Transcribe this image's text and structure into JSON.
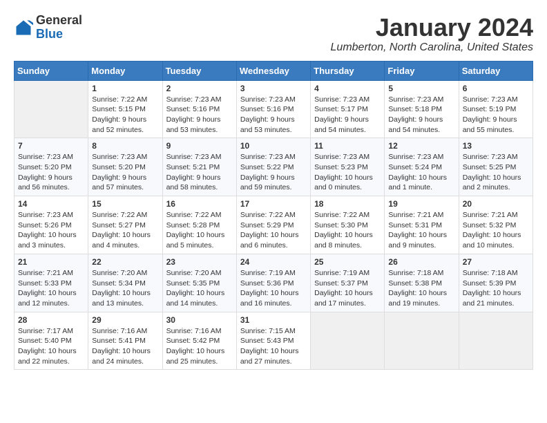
{
  "header": {
    "logo": {
      "general": "General",
      "blue": "Blue"
    },
    "title": "January 2024",
    "subtitle": "Lumberton, North Carolina, United States"
  },
  "calendar": {
    "days_of_week": [
      "Sunday",
      "Monday",
      "Tuesday",
      "Wednesday",
      "Thursday",
      "Friday",
      "Saturday"
    ],
    "weeks": [
      [
        {
          "day": "",
          "sunrise": "",
          "sunset": "",
          "daylight": ""
        },
        {
          "day": "1",
          "sunrise": "Sunrise: 7:22 AM",
          "sunset": "Sunset: 5:15 PM",
          "daylight": "Daylight: 9 hours and 52 minutes."
        },
        {
          "day": "2",
          "sunrise": "Sunrise: 7:23 AM",
          "sunset": "Sunset: 5:16 PM",
          "daylight": "Daylight: 9 hours and 53 minutes."
        },
        {
          "day": "3",
          "sunrise": "Sunrise: 7:23 AM",
          "sunset": "Sunset: 5:16 PM",
          "daylight": "Daylight: 9 hours and 53 minutes."
        },
        {
          "day": "4",
          "sunrise": "Sunrise: 7:23 AM",
          "sunset": "Sunset: 5:17 PM",
          "daylight": "Daylight: 9 hours and 54 minutes."
        },
        {
          "day": "5",
          "sunrise": "Sunrise: 7:23 AM",
          "sunset": "Sunset: 5:18 PM",
          "daylight": "Daylight: 9 hours and 54 minutes."
        },
        {
          "day": "6",
          "sunrise": "Sunrise: 7:23 AM",
          "sunset": "Sunset: 5:19 PM",
          "daylight": "Daylight: 9 hours and 55 minutes."
        }
      ],
      [
        {
          "day": "7",
          "sunrise": "Sunrise: 7:23 AM",
          "sunset": "Sunset: 5:20 PM",
          "daylight": "Daylight: 9 hours and 56 minutes."
        },
        {
          "day": "8",
          "sunrise": "Sunrise: 7:23 AM",
          "sunset": "Sunset: 5:20 PM",
          "daylight": "Daylight: 9 hours and 57 minutes."
        },
        {
          "day": "9",
          "sunrise": "Sunrise: 7:23 AM",
          "sunset": "Sunset: 5:21 PM",
          "daylight": "Daylight: 9 hours and 58 minutes."
        },
        {
          "day": "10",
          "sunrise": "Sunrise: 7:23 AM",
          "sunset": "Sunset: 5:22 PM",
          "daylight": "Daylight: 9 hours and 59 minutes."
        },
        {
          "day": "11",
          "sunrise": "Sunrise: 7:23 AM",
          "sunset": "Sunset: 5:23 PM",
          "daylight": "Daylight: 10 hours and 0 minutes."
        },
        {
          "day": "12",
          "sunrise": "Sunrise: 7:23 AM",
          "sunset": "Sunset: 5:24 PM",
          "daylight": "Daylight: 10 hours and 1 minute."
        },
        {
          "day": "13",
          "sunrise": "Sunrise: 7:23 AM",
          "sunset": "Sunset: 5:25 PM",
          "daylight": "Daylight: 10 hours and 2 minutes."
        }
      ],
      [
        {
          "day": "14",
          "sunrise": "Sunrise: 7:23 AM",
          "sunset": "Sunset: 5:26 PM",
          "daylight": "Daylight: 10 hours and 3 minutes."
        },
        {
          "day": "15",
          "sunrise": "Sunrise: 7:22 AM",
          "sunset": "Sunset: 5:27 PM",
          "daylight": "Daylight: 10 hours and 4 minutes."
        },
        {
          "day": "16",
          "sunrise": "Sunrise: 7:22 AM",
          "sunset": "Sunset: 5:28 PM",
          "daylight": "Daylight: 10 hours and 5 minutes."
        },
        {
          "day": "17",
          "sunrise": "Sunrise: 7:22 AM",
          "sunset": "Sunset: 5:29 PM",
          "daylight": "Daylight: 10 hours and 6 minutes."
        },
        {
          "day": "18",
          "sunrise": "Sunrise: 7:22 AM",
          "sunset": "Sunset: 5:30 PM",
          "daylight": "Daylight: 10 hours and 8 minutes."
        },
        {
          "day": "19",
          "sunrise": "Sunrise: 7:21 AM",
          "sunset": "Sunset: 5:31 PM",
          "daylight": "Daylight: 10 hours and 9 minutes."
        },
        {
          "day": "20",
          "sunrise": "Sunrise: 7:21 AM",
          "sunset": "Sunset: 5:32 PM",
          "daylight": "Daylight: 10 hours and 10 minutes."
        }
      ],
      [
        {
          "day": "21",
          "sunrise": "Sunrise: 7:21 AM",
          "sunset": "Sunset: 5:33 PM",
          "daylight": "Daylight: 10 hours and 12 minutes."
        },
        {
          "day": "22",
          "sunrise": "Sunrise: 7:20 AM",
          "sunset": "Sunset: 5:34 PM",
          "daylight": "Daylight: 10 hours and 13 minutes."
        },
        {
          "day": "23",
          "sunrise": "Sunrise: 7:20 AM",
          "sunset": "Sunset: 5:35 PM",
          "daylight": "Daylight: 10 hours and 14 minutes."
        },
        {
          "day": "24",
          "sunrise": "Sunrise: 7:19 AM",
          "sunset": "Sunset: 5:36 PM",
          "daylight": "Daylight: 10 hours and 16 minutes."
        },
        {
          "day": "25",
          "sunrise": "Sunrise: 7:19 AM",
          "sunset": "Sunset: 5:37 PM",
          "daylight": "Daylight: 10 hours and 17 minutes."
        },
        {
          "day": "26",
          "sunrise": "Sunrise: 7:18 AM",
          "sunset": "Sunset: 5:38 PM",
          "daylight": "Daylight: 10 hours and 19 minutes."
        },
        {
          "day": "27",
          "sunrise": "Sunrise: 7:18 AM",
          "sunset": "Sunset: 5:39 PM",
          "daylight": "Daylight: 10 hours and 21 minutes."
        }
      ],
      [
        {
          "day": "28",
          "sunrise": "Sunrise: 7:17 AM",
          "sunset": "Sunset: 5:40 PM",
          "daylight": "Daylight: 10 hours and 22 minutes."
        },
        {
          "day": "29",
          "sunrise": "Sunrise: 7:16 AM",
          "sunset": "Sunset: 5:41 PM",
          "daylight": "Daylight: 10 hours and 24 minutes."
        },
        {
          "day": "30",
          "sunrise": "Sunrise: 7:16 AM",
          "sunset": "Sunset: 5:42 PM",
          "daylight": "Daylight: 10 hours and 25 minutes."
        },
        {
          "day": "31",
          "sunrise": "Sunrise: 7:15 AM",
          "sunset": "Sunset: 5:43 PM",
          "daylight": "Daylight: 10 hours and 27 minutes."
        },
        {
          "day": "",
          "sunrise": "",
          "sunset": "",
          "daylight": ""
        },
        {
          "day": "",
          "sunrise": "",
          "sunset": "",
          "daylight": ""
        },
        {
          "day": "",
          "sunrise": "",
          "sunset": "",
          "daylight": ""
        }
      ]
    ]
  }
}
